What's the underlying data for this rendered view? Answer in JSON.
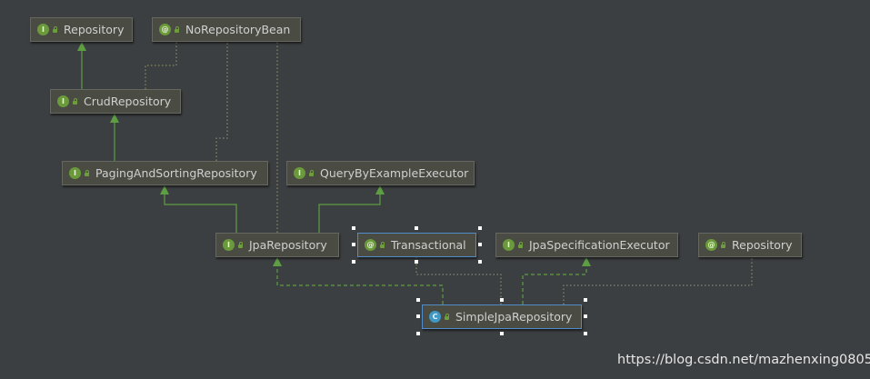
{
  "nodes": [
    {
      "id": "repository",
      "label": "Repository",
      "kind": "interface",
      "badge": "I",
      "selected": false
    },
    {
      "id": "norepositorybean",
      "label": "NoRepositoryBean",
      "kind": "annotation",
      "badge": "@",
      "selected": false
    },
    {
      "id": "crudrepository",
      "label": "CrudRepository",
      "kind": "interface",
      "badge": "I",
      "selected": false
    },
    {
      "id": "pagingandsortingrepository",
      "label": "PagingAndSortingRepository",
      "kind": "interface",
      "badge": "I",
      "selected": false
    },
    {
      "id": "querybyexampleexecutor",
      "label": "QueryByExampleExecutor",
      "kind": "interface",
      "badge": "I",
      "selected": false
    },
    {
      "id": "jparepository",
      "label": "JpaRepository",
      "kind": "interface",
      "badge": "I",
      "selected": false
    },
    {
      "id": "transactional",
      "label": "Transactional",
      "kind": "annotation",
      "badge": "@",
      "selected": true
    },
    {
      "id": "jpaspecificationexecutor",
      "label": "JpaSpecificationExecutor",
      "kind": "interface",
      "badge": "I",
      "selected": false
    },
    {
      "id": "repository-annotation",
      "label": "Repository",
      "kind": "annotation",
      "badge": "@",
      "selected": false
    },
    {
      "id": "simplejparepository",
      "label": "SimpleJpaRepository",
      "kind": "class",
      "badge": "C",
      "selected": true
    }
  ],
  "edges": [
    {
      "from": "crudrepository",
      "to": "repository",
      "type": "extends"
    },
    {
      "from": "pagingandsortingrepository",
      "to": "crudrepository",
      "type": "extends"
    },
    {
      "from": "jparepository",
      "to": "pagingandsortingrepository",
      "type": "extends"
    },
    {
      "from": "jparepository",
      "to": "querybyexampleexecutor",
      "type": "extends"
    },
    {
      "from": "simplejparepository",
      "to": "jparepository",
      "type": "implements"
    },
    {
      "from": "simplejparepository",
      "to": "jpaspecificationexecutor",
      "type": "implements"
    },
    {
      "from": "crudrepository",
      "to": "norepositorybean",
      "type": "annotated"
    },
    {
      "from": "pagingandsortingrepository",
      "to": "norepositorybean",
      "type": "annotated"
    },
    {
      "from": "jparepository",
      "to": "norepositorybean",
      "type": "annotated"
    },
    {
      "from": "simplejparepository",
      "to": "transactional",
      "type": "annotated"
    },
    {
      "from": "simplejparepository",
      "to": "repository-annotation",
      "type": "annotated"
    }
  ],
  "colors": {
    "background": "#3c3f41",
    "node_fill": "#4a4c44",
    "node_border": "#66685f",
    "selected_border": "#4f8cc9",
    "edge": "#5d9e43",
    "annotation_edge": "#9a9a6a",
    "text": "#cfcfcf"
  },
  "watermark": "https://blog.csdn.net/mazhenxing0805"
}
